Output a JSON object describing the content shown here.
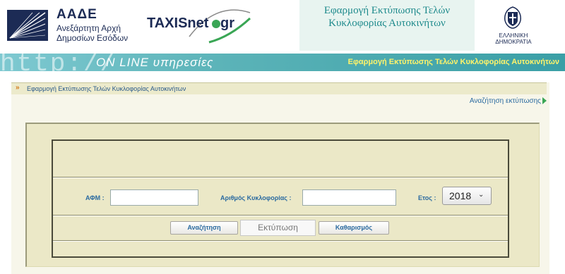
{
  "header": {
    "aade_title": "ΑΑΔΕ",
    "aade_subtitle_line1": "Ανεξάρτητη Αρχή",
    "aade_subtitle_line2": "Δημοσίων Εσόδων",
    "taxisnet_name": "TAXISnet",
    "taxisnet_domain": "gr",
    "app_title_line1": "Εφαρμογή Εκτύπωσης Τελών",
    "app_title_line2": "Κυκλοφορίας Αυτοκινήτων",
    "government_label": "ΕΛΛΗΝΙΚΗ ΔΗΜΟΚΡΑΤΙΑ"
  },
  "banner": {
    "http_text": "http://",
    "online_text": "ON LINE υπηρεσίες",
    "title": "Εφαρμογή Εκτύπωσης Τελών Κυκλοφορίας Αυτοκινήτων"
  },
  "breadcrumb": {
    "text": "Εφαρμογή Εκτύπωσης Τελών Κυκλοφορίας Αυτοκινήτων"
  },
  "search_link": "Αναζήτηση εκτύπωσης",
  "form": {
    "afm_label": "ΑΦΜ :",
    "afm_value": "",
    "plate_label": "Αριθμός Κυκλοφορίας :",
    "plate_value": "",
    "year_label": "Ετος :",
    "year_value": "2018"
  },
  "buttons": {
    "search": "Αναζήτηση",
    "print": "Εκτύπωση",
    "clear": "Καθαρισμός"
  },
  "colors": {
    "banner_teal": "#5bb3b8",
    "panel_beige": "#ebe8c7",
    "label_blue": "#2a6aa0",
    "banner_title_yellow": "#fff36a"
  }
}
